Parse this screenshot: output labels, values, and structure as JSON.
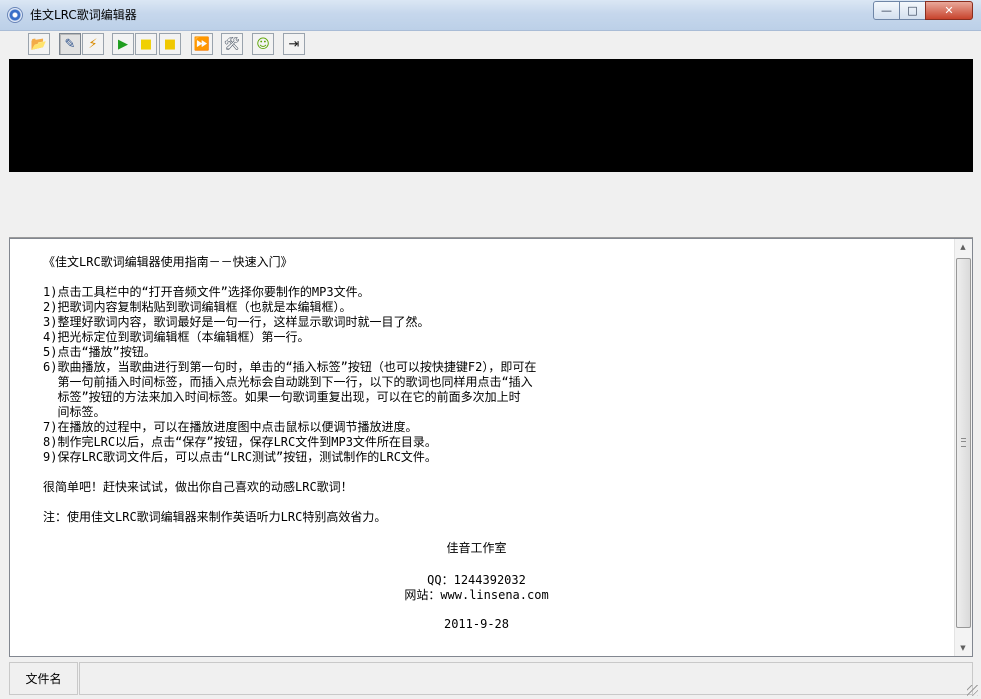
{
  "window": {
    "title": "佳文LRC歌词编辑器"
  },
  "window_controls": {
    "minimize": "—",
    "maximize": "□",
    "close": "✕"
  },
  "toolbar": {
    "buttons": [
      {
        "name": "open-audio-file-button",
        "icon": "folder-open-icon",
        "glyph": "📂",
        "color": "#c89c22"
      },
      {
        "name": "edit-lyrics-button",
        "icon": "edit-document-icon",
        "glyph": "✎",
        "color": "#2b4f8a"
      },
      {
        "name": "lrc-test-button",
        "icon": "lightning-icon",
        "glyph": "⚡",
        "color": "#d98a00"
      },
      {
        "name": "play-button",
        "icon": "play-icon",
        "glyph": "▶",
        "color": "#1f9e1f"
      },
      {
        "name": "pause-button",
        "icon": "pause-icon",
        "glyph": "■",
        "color": "#f0d000"
      },
      {
        "name": "stop-button",
        "icon": "stop-icon",
        "glyph": "■",
        "color": "#f0c800"
      },
      {
        "name": "insert-tag-button",
        "icon": "fast-forward-icon",
        "glyph": "⏩",
        "color": "#1b4fb8"
      },
      {
        "name": "settings-button",
        "icon": "tools-icon",
        "glyph": "🛠",
        "color": "#3e4a5a"
      },
      {
        "name": "help-button",
        "icon": "help-smiley-icon",
        "glyph": "☺",
        "color": "#5aa400"
      },
      {
        "name": "exit-button",
        "icon": "exit-door-icon",
        "glyph": "⇥",
        "color": "#1a1a1a"
      }
    ]
  },
  "editor": {
    "lines": [
      "《佳文LRC歌词编辑器使用指南－－快速入门》",
      "",
      "1)点击工具栏中的“打开音频文件”选择你要制作的MP3文件。",
      "2)把歌词内容复制粘贴到歌词编辑框（也就是本编辑框）。",
      "3)整理好歌词内容，歌词最好是一句一行，这样显示歌词时就一目了然。",
      "4)把光标定位到歌词编辑框（本编辑框）第一行。",
      "5)点击“播放”按钮。",
      "6)歌曲播放，当歌曲进行到第一句时，单击的“插入标签”按钮（也可以按快捷键F2），即可在",
      "  第一句前插入时间标签，而插入点光标会自动跳到下一行，以下的歌词也同样用点击“插入",
      "  标签”按钮的方法来加入时间标签。如果一句歌词重复出现，可以在它的前面多次加上时",
      "  间标签。",
      "7)在播放的过程中，可以在播放进度图中点击鼠标以便调节播放进度。",
      "8)制作完LRC以后，点击“保存”按钮，保存LRC文件到MP3文件所在目录。",
      "9)保存LRC歌词文件后，可以点击“LRC测试”按钮，测试制作的LRC文件。",
      "",
      "很简单吧！赶快来试试，做出你自己喜欢的动感LRC歌词！",
      "",
      "注：使用佳文LRC歌词编辑器来制作英语听力LRC特别高效省力。"
    ],
    "signature": {
      "studio": "佳音工作室",
      "qq": "QQ：1244392032",
      "website": "网站：www.linsena.com",
      "date": "2011-9-28"
    }
  },
  "scrollbar": {
    "up": "▲",
    "down": "▼"
  },
  "statusbar": {
    "file_label": "文件名"
  }
}
